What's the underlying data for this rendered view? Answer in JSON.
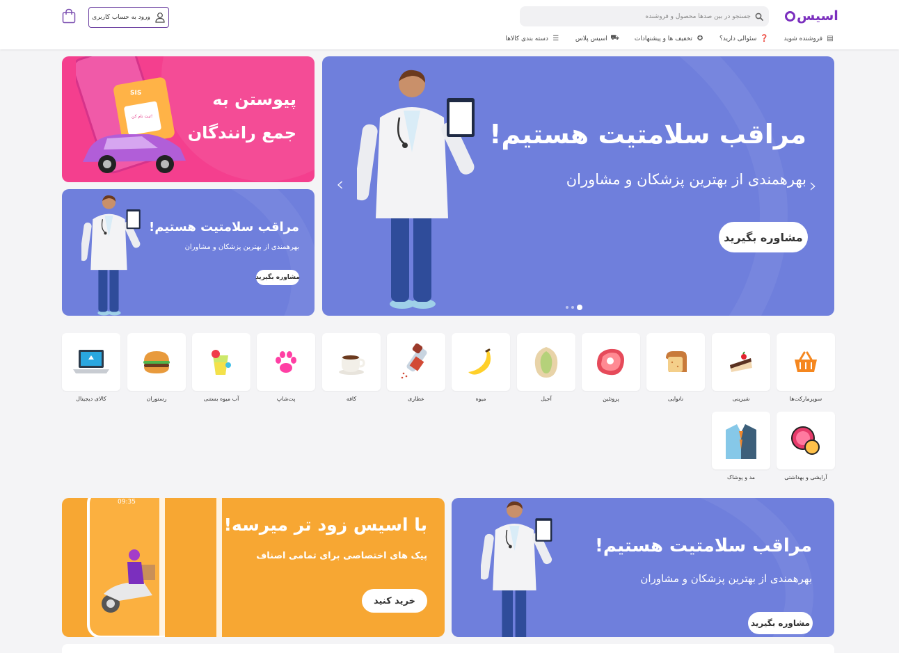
{
  "header": {
    "logo_text": "اسیس",
    "search_placeholder": "جستجو در بین صدها محصول و فروشنده",
    "login_label": "ورود به حساب کاربری",
    "nav": [
      {
        "label": "دسته بندی کالاها",
        "icon": "menu-icon"
      },
      {
        "label": "اسیس پلاس",
        "icon": "truck-icon"
      },
      {
        "label": "تخفیف ها و پیشنهادات",
        "icon": "discount-icon"
      },
      {
        "label": "سئوالی دارید؟",
        "icon": "question-icon"
      },
      {
        "label": "فروشنده شوید",
        "icon": "store-icon"
      }
    ]
  },
  "hero": {
    "title": "مراقب سلامتیت هستیم!",
    "subtitle": "بهرهمندی از بهترین پزشکان و مشاوران",
    "button": "مشاوره بگیرید",
    "slide_count": 3,
    "active_slide": 1
  },
  "side_top": {
    "line1": "پیوستن به",
    "line2": "جمع رانندگان",
    "card_brand": "SIS",
    "card_button": "ثبت نام کن!"
  },
  "side_bottom": {
    "title": "مراقب سلامتیت هستیم!",
    "subtitle": "بهرهمندی از بهترین پزشکان و مشاوران",
    "button": "مشاوره بگیرید"
  },
  "categories": [
    {
      "label": "سوپرمارکت‌ها",
      "icon": "basket-icon"
    },
    {
      "label": "شیرینی",
      "icon": "cake-icon"
    },
    {
      "label": "نانوایی",
      "icon": "bread-icon"
    },
    {
      "label": "پروتئین",
      "icon": "steak-icon"
    },
    {
      "label": "آجیل",
      "icon": "pistachio-icon"
    },
    {
      "label": "میوه",
      "icon": "banana-icon"
    },
    {
      "label": "عطاری",
      "icon": "spice-shaker-icon"
    },
    {
      "label": "کافه",
      "icon": "coffee-cup-icon"
    },
    {
      "label": "پت‌شاپ",
      "icon": "paw-icon"
    },
    {
      "label": "آب میوه بستنی",
      "icon": "juice-icon"
    },
    {
      "label": "رستوران",
      "icon": "burger-icon"
    },
    {
      "label": "کالای دیجیتال",
      "icon": "laptop-icon"
    },
    {
      "label": "آرایشی و بهداشتی",
      "icon": "makeup-icon"
    },
    {
      "label": "مد و پوشاک",
      "icon": "suit-icon"
    }
  ],
  "promo_orange": {
    "title": "با اسیس زود تر میرسه!",
    "subtitle": "پیک های اختصاصی برای تمامی اصناف",
    "button": "خرید کنید",
    "phone_time": "09:35"
  },
  "promo_blue": {
    "title": "مراقب سلامتیت هستیم!",
    "subtitle": "بهرهمندی از بهترین پزشکان و مشاوران",
    "button": "مشاوره بگیرید"
  }
}
